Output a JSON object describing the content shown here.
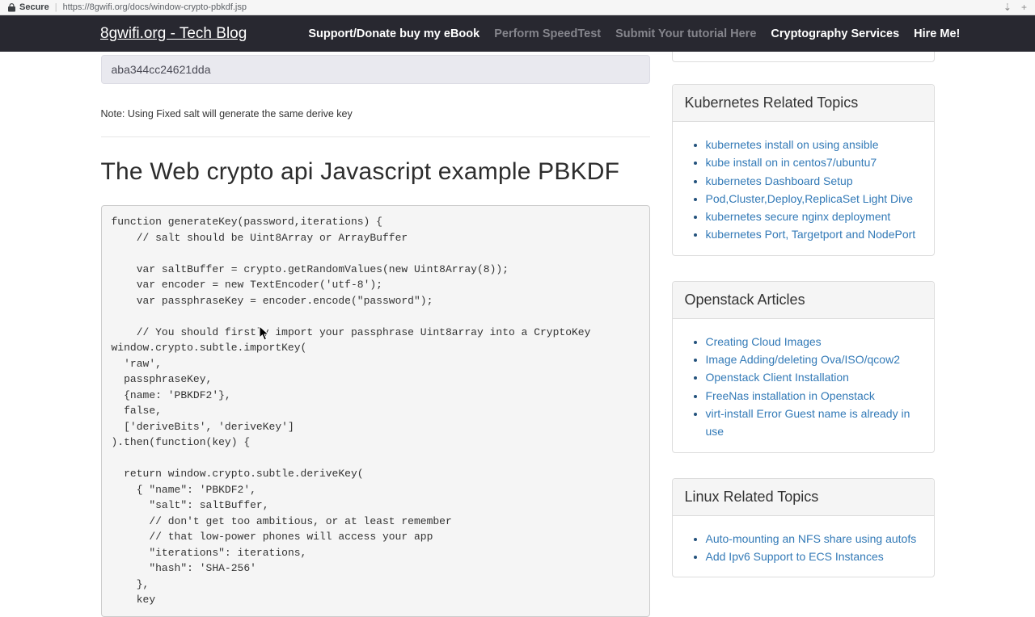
{
  "browser": {
    "security_label": "Secure",
    "url": "https://8gwifi.org/docs/window-crypto-pbkdf.jsp",
    "divider": "|"
  },
  "navbar": {
    "brand": "8gwifi.org - Tech Blog",
    "items": [
      {
        "label": "Support/Donate buy my eBook"
      },
      {
        "label": "Perform SpeedTest"
      },
      {
        "label": "Submit Your tutorial Here"
      },
      {
        "label": "Cryptography Services"
      },
      {
        "label": "Hire Me!"
      }
    ]
  },
  "main": {
    "salt_value": "aba344cc24621dda",
    "note": "Note: Using Fixed salt will generate the same derive key",
    "heading": "The Web crypto api Javascript example PBKDF",
    "code": "function generateKey(password,iterations) {\n    // salt should be Uint8Array or ArrayBuffer\n\n    var saltBuffer = crypto.getRandomValues(new Uint8Array(8));\n    var encoder = new TextEncoder('utf-8');\n    var passphraseKey = encoder.encode(\"password\");\n\n    // You should firstly import your passphrase Uint8array into a CryptoKey\nwindow.crypto.subtle.importKey(\n  'raw',\n  passphraseKey,\n  {name: 'PBKDF2'},\n  false,\n  ['deriveBits', 'deriveKey']\n).then(function(key) {\n\n  return window.crypto.subtle.deriveKey(\n    { \"name\": 'PBKDF2',\n      \"salt\": saltBuffer,\n      // don't get too ambitious, or at least remember\n      // that low-power phones will access your app\n      \"iterations\": iterations,\n      \"hash\": 'SHA-256'\n    },\n    key"
  },
  "sidebar": {
    "panels": [
      {
        "title": "Kubernetes Related Topics",
        "links": [
          "kubernetes install on using ansible",
          "kube install on in centos7/ubuntu7",
          "kubernetes Dashboard Setup",
          "Pod,Cluster,Deploy,ReplicaSet Light Dive",
          "kubernetes secure nginx deployment",
          "kubernetes Port, Targetport and NodePort"
        ]
      },
      {
        "title": "Openstack Articles",
        "links": [
          "Creating Cloud Images",
          "Image Adding/deleting Ova/ISO/qcow2",
          "Openstack Client Installation",
          "FreeNas installation in Openstack",
          "virt-install Error Guest name is already in use"
        ]
      },
      {
        "title": "Linux Related Topics",
        "links": [
          "Auto-mounting an NFS share using autofs",
          "Add Ipv6 Support to ECS Instances"
        ]
      }
    ]
  },
  "colors": {
    "link": "#337ab7",
    "navbar_bg": "#282830",
    "panel_heading_bg": "#f5f5f5",
    "code_bg": "#f5f5f5"
  }
}
